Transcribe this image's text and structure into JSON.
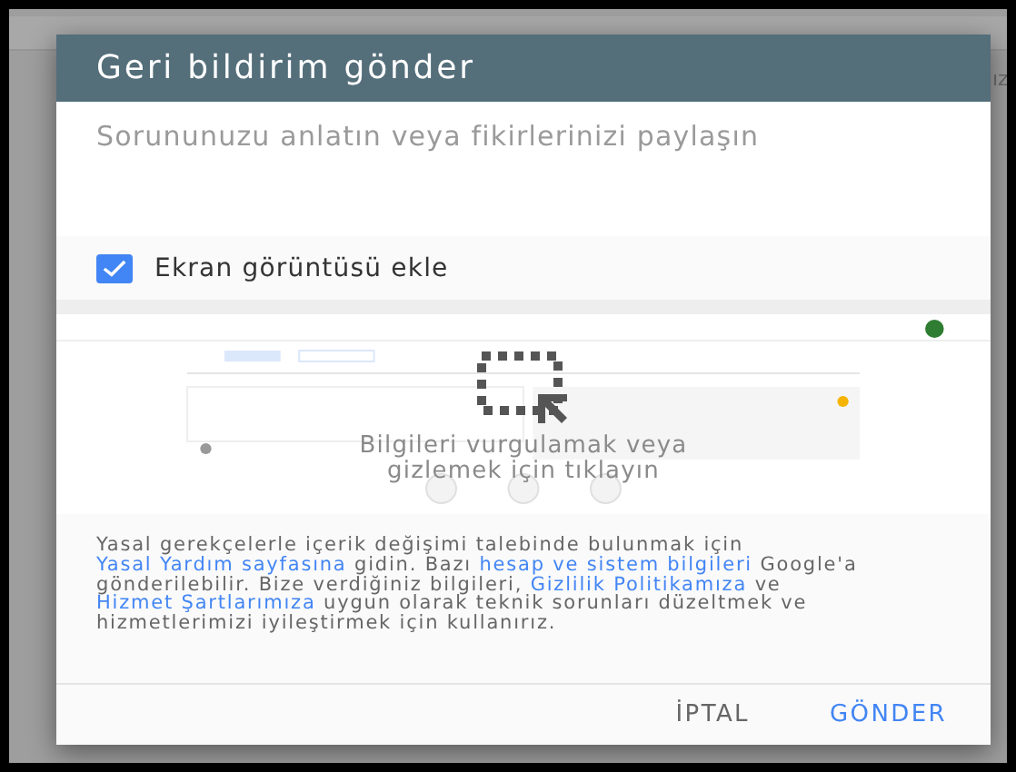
{
  "background": {
    "text_fragment": "ız"
  },
  "dialog": {
    "title": "Geri bildirim gönder",
    "description_field": {
      "placeholder": "Sorununuzu anlatın veya fikirlerinizi paylaşın"
    },
    "screenshot_option": {
      "label": "Ekran görüntüsü ekle",
      "checked": true
    },
    "screenshot_preview": {
      "hint": "Bilgileri vurgulamak veya gizlemek için tıklayın"
    },
    "legal_text": [
      {
        "kind": "text",
        "text": "Yasal gerekçelerle içerik değişimi talebinde bulunmak için"
      },
      {
        "kind": "link",
        "text": "Yasal Yardım sayfasına"
      },
      {
        "kind": "text",
        "text": "gidin. Bazı"
      },
      {
        "kind": "link",
        "text": "hesap ve sistem bilgileri"
      },
      {
        "kind": "text",
        "text": "Google'a gönderilebilir. Bize verdiğiniz bilgileri,"
      },
      {
        "kind": "link",
        "text": "Gizlilik Politikamıza"
      },
      {
        "kind": "text",
        "text": "ve"
      },
      {
        "kind": "link",
        "text": "Hizmet Şartlarımıza"
      },
      {
        "kind": "text",
        "text": "uygun olarak teknik sorunları düzeltmek ve hizmetlerimizi iyileştirmek için kullanırız."
      }
    ],
    "buttons": [
      {
        "label": "İPTAL",
        "primary": false
      },
      {
        "label": "GÖNDER",
        "primary": true
      }
    ]
  }
}
